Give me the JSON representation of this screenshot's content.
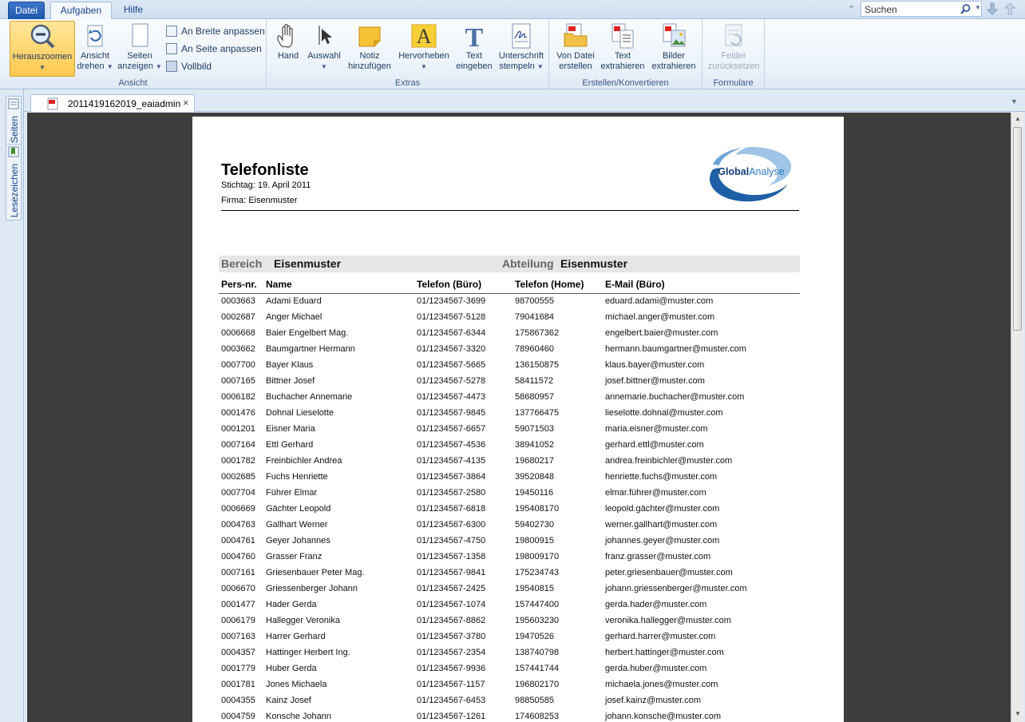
{
  "menu": {
    "tabs": [
      "Datei",
      "Aufgaben",
      "Hilfe"
    ]
  },
  "search": {
    "placeholder": "Suchen"
  },
  "ribbon": {
    "ansicht": {
      "label": "Ansicht",
      "herauszoomen": "Herauszoomen",
      "ansicht_drehen": [
        "Ansicht",
        "drehen"
      ],
      "seiten_anzeigen": [
        "Seiten",
        "anzeigen"
      ],
      "an_breite": "An Breite anpassen",
      "an_seite": "An Seite anpassen",
      "vollbild": "Vollbild"
    },
    "extras": {
      "label": "Extras",
      "hand": "Hand",
      "auswahl": "Auswahl",
      "notiz": [
        "Notiz",
        "hinzufügen"
      ],
      "hervorheben": "Hervorheben",
      "text_eingeben": [
        "Text",
        "eingeben"
      ],
      "unterschrift": [
        "Unterschrift",
        "stempeln"
      ]
    },
    "erstellen": {
      "label": "Erstellen/Konvertieren",
      "von_datei": [
        "Von Datei",
        "erstellen"
      ],
      "text_extrahieren": [
        "Text",
        "extrahieren"
      ],
      "bilder_extrahieren": [
        "Bilder",
        "extrahieren"
      ]
    },
    "formulare": {
      "label": "Formulare",
      "felder": [
        "Felder",
        "zurücksetzen"
      ]
    }
  },
  "sidepanel": {
    "seiten": "Seiten",
    "lesezeichen": "Lesezeichen"
  },
  "document_tab": {
    "title": "2011419162019_eaiadmin",
    "close": "×"
  },
  "report": {
    "title": "Telefonliste",
    "stichtag": "Stichtag: 19. April 2011",
    "firma": "Firma: Eisenmuster",
    "logo_text": [
      "Global",
      "Analyse"
    ],
    "bereich_label": "Bereich",
    "bereich_value": "Eisenmuster",
    "abteilung_label": "Abteilung",
    "abteilung_value": "Eisenmuster",
    "columns": [
      "Pers-nr.",
      "Name",
      "Telefon (Büro)",
      "Telefon (Home)",
      "E-Mail (Büro)"
    ],
    "rows": [
      [
        "0003663",
        "Adami Eduard",
        "01/1234567-3699",
        "98700555",
        "eduard.adami@muster.com"
      ],
      [
        "0002687",
        "Anger Michael",
        "01/1234567-5128",
        "79041684",
        "michael.anger@muster.com"
      ],
      [
        "0006668",
        "Baier Engelbert Mag.",
        "01/1234567-6344",
        "175867362",
        "engelbert.baier@muster.com"
      ],
      [
        "0003662",
        "Baumgartner Hermann",
        "01/1234567-3320",
        "78960460",
        "hermann.baumgartner@muster.com"
      ],
      [
        "0007700",
        "Bayer Klaus",
        "01/1234567-5665",
        "136150875",
        "klaus.bayer@muster.com"
      ],
      [
        "0007165",
        "Bittner Josef",
        "01/1234567-5278",
        "58411572",
        "josef.bittner@muster.com"
      ],
      [
        "0006182",
        "Buchacher Annemarie",
        "01/1234567-4473",
        "58680957",
        "annemarie.buchacher@muster.com"
      ],
      [
        "0001476",
        "Dohnal Lieselotte",
        "01/1234567-9845",
        "137766475",
        "lieselotte.dohnal@muster.com"
      ],
      [
        "0001201",
        "Eisner Maria",
        "01/1234567-6657",
        "59071503",
        "maria.eisner@muster.com"
      ],
      [
        "0007164",
        "Ettl Gerhard",
        "01/1234567-4536",
        "38941052",
        "gerhard.ettl@muster.com"
      ],
      [
        "0001782",
        "Freinbichler Andrea",
        "01/1234567-4135",
        "19680217",
        "andrea.freinbichler@muster.com"
      ],
      [
        "0002685",
        "Fuchs Henriette",
        "01/1234567-3864",
        "39520848",
        "henriette.fuchs@muster.com"
      ],
      [
        "0007704",
        "Führer Elmar",
        "01/1234567-2580",
        "19450116",
        "elmar.führer@muster.com"
      ],
      [
        "0006669",
        "Gächter Leopold",
        "01/1234567-6818",
        "195408170",
        "leopold.gächter@muster.com"
      ],
      [
        "0004763",
        "Gallhart Werner",
        "01/1234567-6300",
        "59402730",
        "werner.gallhart@muster.com"
      ],
      [
        "0004761",
        "Geyer Johannes",
        "01/1234567-4750",
        "19800915",
        "johannes.geyer@muster.com"
      ],
      [
        "0004760",
        "Grasser Franz",
        "01/1234567-1358",
        "198009170",
        "franz.grasser@muster.com"
      ],
      [
        "0007161",
        "Griesenbauer Peter Mag.",
        "01/1234567-9841",
        "175234743",
        "peter.griesenbauer@muster.com"
      ],
      [
        "0006670",
        "Griessenberger Johann",
        "01/1234567-2425",
        "19540815",
        "johann.griessenberger@muster.com"
      ],
      [
        "0001477",
        "Hader Gerda",
        "01/1234567-1074",
        "157447400",
        "gerda.hader@muster.com"
      ],
      [
        "0006179",
        "Hallegger Veronika",
        "01/1234567-8862",
        "195603230",
        "veronika.hallegger@muster.com"
      ],
      [
        "0007163",
        "Harrer Gerhard",
        "01/1234567-3780",
        "19470526",
        "gerhard.harrer@muster.com"
      ],
      [
        "0004357",
        "Hattinger Herbert Ing.",
        "01/1234567-2354",
        "138740798",
        "herbert.hattinger@muster.com"
      ],
      [
        "0001779",
        "Huber Gerda",
        "01/1234567-9936",
        "157441744",
        "gerda.huber@muster.com"
      ],
      [
        "0001781",
        "Jones Michaela",
        "01/1234567-1157",
        "196802170",
        "michaela.jones@muster.com"
      ],
      [
        "0004355",
        "Kainz Josef",
        "01/1234567-6453",
        "98850585",
        "josef.kainz@muster.com"
      ],
      [
        "0004759",
        "Konsche Johann",
        "01/1234567-1261",
        "174608253",
        "johann.konsche@muster.com"
      ]
    ]
  }
}
